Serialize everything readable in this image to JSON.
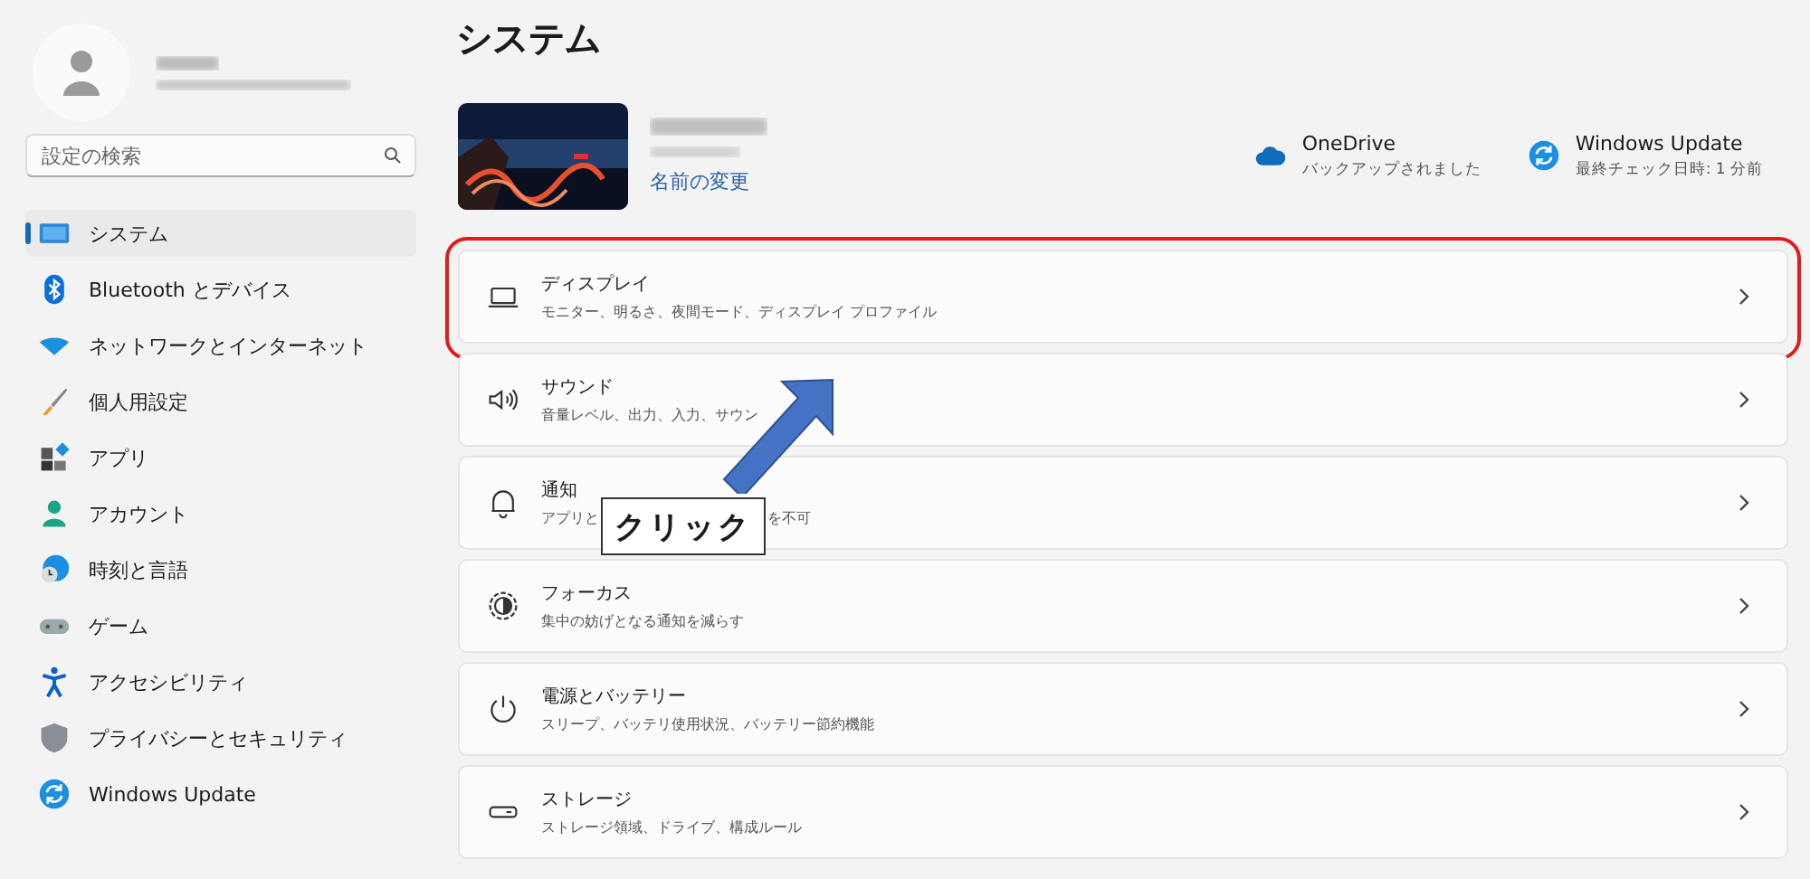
{
  "sidebar": {
    "search": {
      "placeholder": "設定の検索"
    },
    "items": [
      {
        "label": "システム",
        "selected": true
      },
      {
        "label": "Bluetooth とデバイス",
        "selected": false
      },
      {
        "label": "ネットワークとインターネット",
        "selected": false
      },
      {
        "label": "個人用設定",
        "selected": false
      },
      {
        "label": "アプリ",
        "selected": false
      },
      {
        "label": "アカウント",
        "selected": false
      },
      {
        "label": "時刻と言語",
        "selected": false
      },
      {
        "label": "ゲーム",
        "selected": false
      },
      {
        "label": "アクセシビリティ",
        "selected": false
      },
      {
        "label": "プライバシーとセキュリティ",
        "selected": false
      },
      {
        "label": "Windows Update",
        "selected": false
      }
    ]
  },
  "page_title": "システム",
  "device": {
    "rename_link": "名前の変更"
  },
  "status": [
    {
      "title": "OneDrive",
      "subtitle": "バックアップされました"
    },
    {
      "title": "Windows Update",
      "subtitle": "最終チェック日時: 1 分前"
    }
  ],
  "settings": [
    {
      "title": "ディスプレイ",
      "subtitle_parts": [
        "モニター、明るさ、夜間モード、ディスプレイ プロファイル"
      ],
      "highlighted": true
    },
    {
      "title": "サウンド",
      "subtitle_parts": [
        "音量レベル、出力、入力、サウン"
      ],
      "highlighted": false
    },
    {
      "title": "通知",
      "subtitle_parts": [
        "アプリと",
        "を不可"
      ],
      "highlighted": false
    },
    {
      "title": "フォーカス",
      "subtitle_parts": [
        "集中の妨げとなる通知を減らす"
      ],
      "highlighted": false
    },
    {
      "title": "電源とバッテリー",
      "subtitle_parts": [
        "スリープ、バッテリ使用状況、バッテリー節約機能"
      ],
      "highlighted": false
    },
    {
      "title": "ストレージ",
      "subtitle_parts": [
        "ストレージ領域、ドライブ、構成ルール"
      ],
      "highlighted": false
    }
  ],
  "callout": {
    "label": "クリック"
  }
}
